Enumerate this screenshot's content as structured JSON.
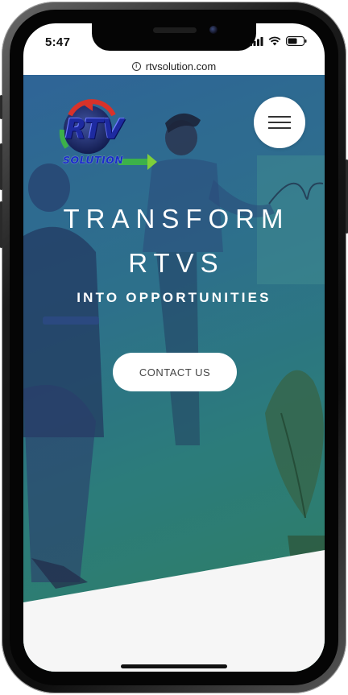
{
  "status_bar": {
    "time": "5:47"
  },
  "browser": {
    "url": "rtvsolution.com"
  },
  "header": {
    "logo_main": "RTV",
    "logo_sub": "SOLUTION",
    "menu_icon": "hamburger-menu-icon"
  },
  "hero": {
    "line1": "TRANSFORM",
    "line2": "RTVS",
    "line3": "INTO OPPORTUNITIES",
    "cta_label": "CONTACT US"
  },
  "colors": {
    "hero_gradient_start": "#2f5ea2",
    "hero_gradient_end": "#2f7d62",
    "logo_blue": "#1d2aa0",
    "arrow_red": "#d8322a",
    "arrow_green": "#3cb14a"
  }
}
